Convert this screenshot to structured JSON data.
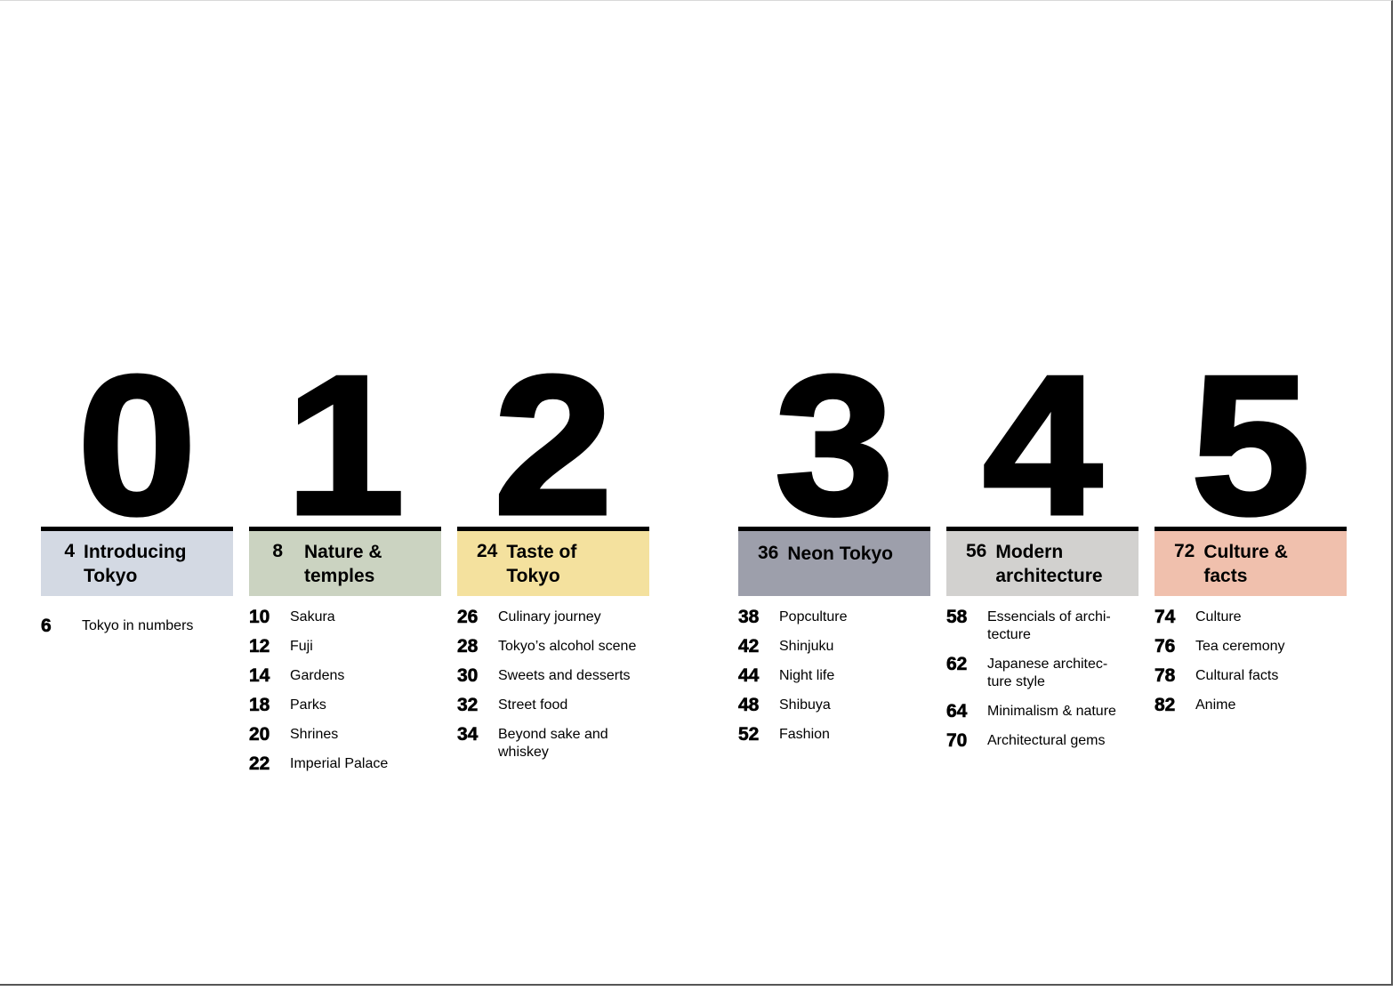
{
  "colors": {
    "chapter_0": "#d3d9e3",
    "chapter_1": "#cbd3c1",
    "chapter_2": "#f4e19e",
    "chapter_3": "#9d9fab",
    "chapter_4": "#d2d1cf",
    "chapter_5": "#f0c0ad"
  },
  "chapters": [
    {
      "number": "0",
      "page": "4",
      "title": "Introducing Tokyo",
      "entries": [
        {
          "page": "6",
          "title": "Tokyo in numbers"
        }
      ]
    },
    {
      "number": "1",
      "page": "8",
      "title": "Nature & temples",
      "entries": [
        {
          "page": "10",
          "title": "Sakura"
        },
        {
          "page": "12",
          "title": "Fuji"
        },
        {
          "page": "14",
          "title": "Gardens"
        },
        {
          "page": "18",
          "title": "Parks"
        },
        {
          "page": "20",
          "title": "Shrines"
        },
        {
          "page": "22",
          "title": "Imperial Palace"
        }
      ]
    },
    {
      "number": "2",
      "page": "24",
      "title": "Taste of Tokyo",
      "entries": [
        {
          "page": "26",
          "title": "Culinary journey"
        },
        {
          "page": "28",
          "title": "Tokyo’s alcohol scene"
        },
        {
          "page": "30",
          "title": "Sweets and desserts"
        },
        {
          "page": "32",
          "title": "Street food"
        },
        {
          "page": "34",
          "title": "Beyond sake and whiskey"
        }
      ]
    },
    {
      "number": "3",
      "page": "36",
      "title": "Neon Tokyo",
      "entries": [
        {
          "page": "38",
          "title": "Popculture"
        },
        {
          "page": "42",
          "title": "Shinjuku"
        },
        {
          "page": "44",
          "title": "Night life"
        },
        {
          "page": "48",
          "title": "Shibuya"
        },
        {
          "page": "52",
          "title": "Fashion"
        }
      ]
    },
    {
      "number": "4",
      "page": "56",
      "title": "Modern architecture",
      "entries": [
        {
          "page": "58",
          "title": "Essencials of archi-tecture"
        },
        {
          "page": "62",
          "title": "Japanese architec-ture style"
        },
        {
          "page": "64",
          "title": "Minimalism & nature"
        },
        {
          "page": "70",
          "title": "Architectural gems"
        }
      ]
    },
    {
      "number": "5",
      "page": "72",
      "title": "Culture & facts",
      "entries": [
        {
          "page": "74",
          "title": "Culture"
        },
        {
          "page": "76",
          "title": "Tea ceremony"
        },
        {
          "page": "78",
          "title": "Cultural facts"
        },
        {
          "page": "82",
          "title": "Anime"
        }
      ]
    }
  ]
}
